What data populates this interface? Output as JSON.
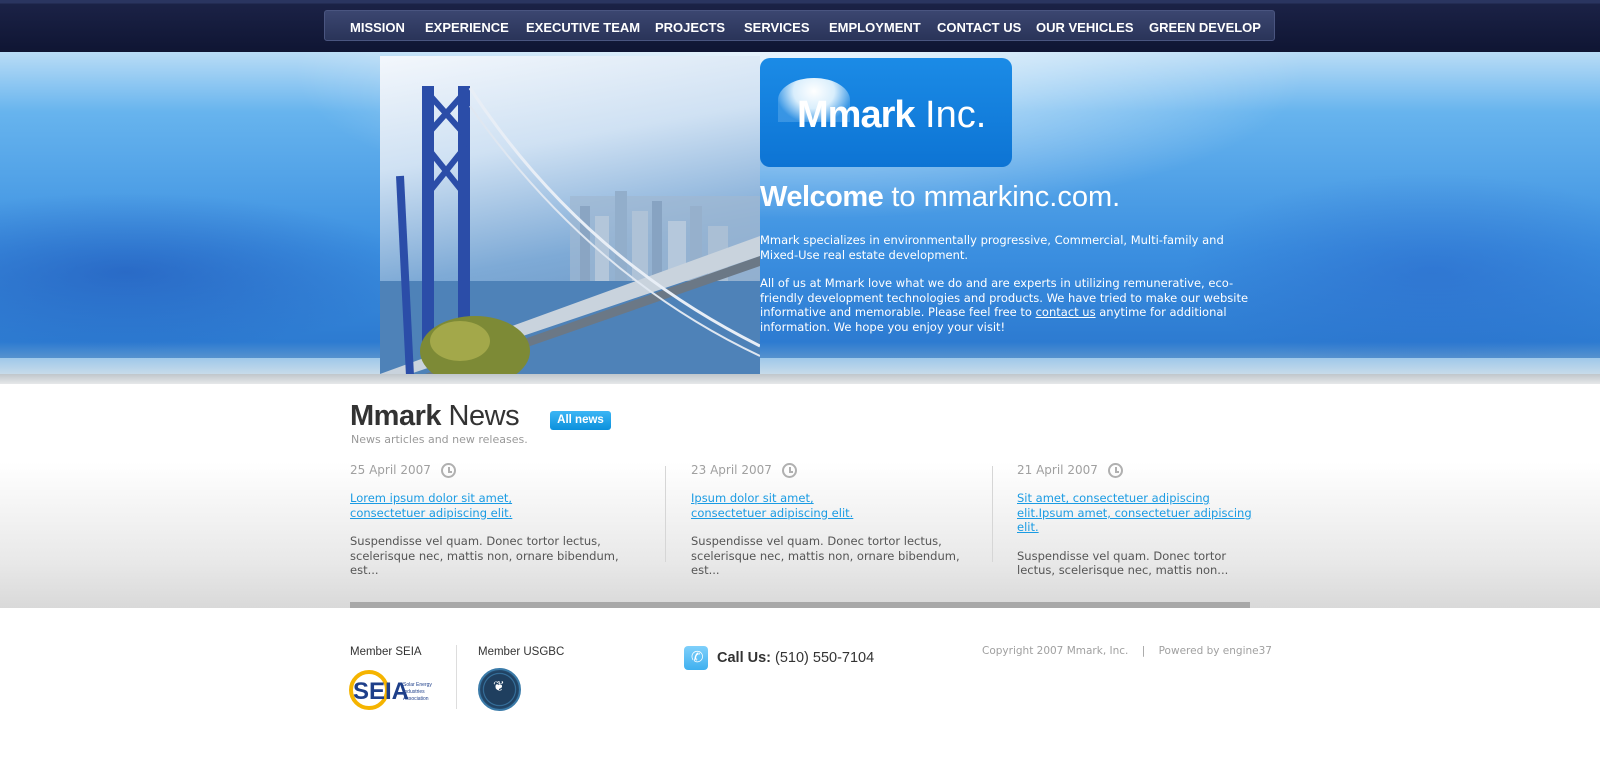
{
  "nav": {
    "items": [
      {
        "label": "MISSION"
      },
      {
        "label": "EXPERIENCE"
      },
      {
        "label": "EXECUTIVE TEAM"
      },
      {
        "label": "PROJECTS"
      },
      {
        "label": "SERVICES"
      },
      {
        "label": "EMPLOYMENT"
      },
      {
        "label": "CONTACT US"
      },
      {
        "label": "OUR VEHICLES"
      },
      {
        "label": "GREEN DEVELOP"
      }
    ]
  },
  "logo": {
    "brand_bold": "Mmark",
    "brand_rest": " Inc."
  },
  "hero": {
    "welcome_bold": "Welcome",
    "welcome_rest": " to mmarkinc.com.",
    "para1": "Mmark specializes in environmentally progressive, Commercial, Multi-family and Mixed-Use real estate development.",
    "para2_before": "All of us at Mmark love what we do and are experts in utilizing remunerative, eco-friendly development technologies and products. We have tried to make our website informative and memorable.  Please feel free to ",
    "para2_link": "contact us",
    "para2_after": " anytime for additional information.  We hope you enjoy your visit!"
  },
  "news": {
    "title_bold": "Mmark",
    "title_rest": " News",
    "subtitle": "News articles and new releases.",
    "all_news_label": "All news",
    "items": [
      {
        "date": "25 April 2007",
        "headline": "Lorem ipsum dolor sit amet, consectetuer adipiscing elit.",
        "excerpt": "Suspendisse vel quam. Donec tortor lectus, scelerisque nec, mattis non, ornare bibendum, est..."
      },
      {
        "date": "23 April 2007",
        "headline": "Ipsum dolor sit amet, consectetuer adipiscing elit.",
        "excerpt": "Suspendisse vel quam. Donec tortor lectus, scelerisque nec, mattis non, ornare bibendum, est..."
      },
      {
        "date": "21 April 2007",
        "headline": "Sit amet, consectetuer adipiscing elit.Ipsum amet, consectetuer adipiscing elit.",
        "excerpt": "Suspendisse vel quam. Donec tortor lectus, scelerisque nec, mattis non..."
      }
    ]
  },
  "footer": {
    "member_seia": "Member SEIA",
    "member_usgbc": "Member USGBC",
    "seia_logo_text": "SEIA",
    "seia_logo_sub": "Solar Energy Industries Association",
    "call_label": "Call Us:",
    "phone": " (510) 550-7104",
    "copyright": "Copyright 2007 Mmark, Inc.    |    Powered by engine37"
  },
  "colors": {
    "accent": "#1a9be3",
    "nav_bg": "#1b2246",
    "logo_bg": "#1b8be6"
  }
}
